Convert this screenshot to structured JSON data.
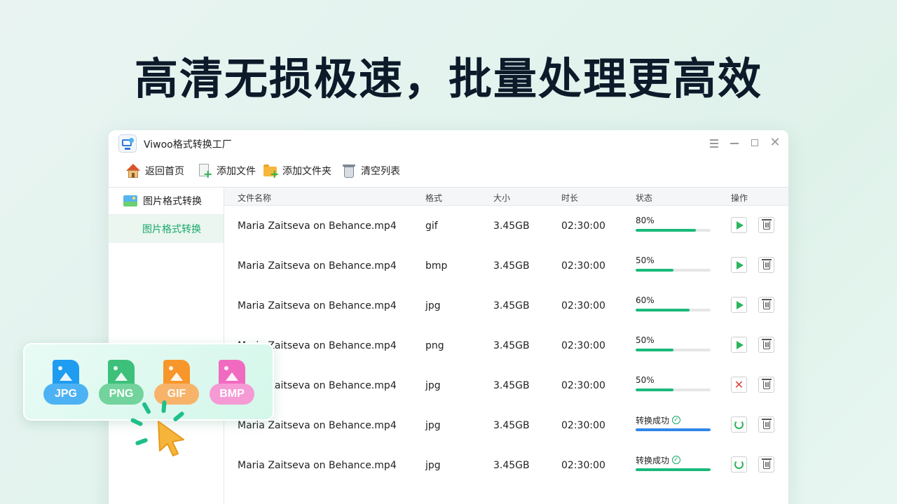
{
  "headline": "高清无损极速，批量处理更高效",
  "window": {
    "title": "Viwoo格式转换工厂",
    "controls": [
      "menu-icon",
      "minimize-icon",
      "maximize-icon",
      "close-icon"
    ]
  },
  "toolbar": {
    "home": "返回首页",
    "add_file": "添加文件",
    "add_folder": "添加文件夹",
    "clear_list": "清空列表"
  },
  "sidebar": {
    "group": "图片格式转换",
    "items": [
      {
        "label": "图片格式转换",
        "active": true
      }
    ]
  },
  "table": {
    "headers": {
      "name": "文件名称",
      "format": "格式",
      "size": "大小",
      "duration": "时长",
      "status": "状态",
      "actions": "操作"
    },
    "rows": [
      {
        "name": "Maria Zaitseva on Behance.mp4",
        "format": "gif",
        "size": "3.45GB",
        "duration": "02:30:00",
        "status": "80%",
        "progress": 0.8,
        "bar_color": "#19b97a",
        "action": "play"
      },
      {
        "name": "Maria Zaitseva on Behance.mp4",
        "format": "bmp",
        "size": "3.45GB",
        "duration": "02:30:00",
        "status": "50%",
        "progress": 0.5,
        "bar_color": "#19b97a",
        "action": "play"
      },
      {
        "name": "Maria Zaitseva on Behance.mp4",
        "format": "jpg",
        "size": "3.45GB",
        "duration": "02:30:00",
        "status": "60%",
        "progress": 0.72,
        "bar_color": "#19b97a",
        "action": "play"
      },
      {
        "name": "Maria Zaitseva on Behance.mp4",
        "format": "png",
        "size": "3.45GB",
        "duration": "02:30:00",
        "status": "50%",
        "progress": 0.5,
        "bar_color": "#19b97a",
        "action": "play"
      },
      {
        "name": "Maria Zaitseva on Behance.mp4",
        "format": "jpg",
        "size": "3.45GB",
        "duration": "02:30:00",
        "status": "50%",
        "progress": 0.5,
        "bar_color": "#19b97a",
        "action": "stop"
      },
      {
        "name": "Maria Zaitseva on Behance.mp4",
        "format": "jpg",
        "size": "3.45GB",
        "duration": "02:30:00",
        "status": "转换成功",
        "progress": 1.0,
        "bar_color": "#2f86e8",
        "action": "redo"
      },
      {
        "name": "Maria Zaitseva on Behance.mp4",
        "format": "jpg",
        "size": "3.45GB",
        "duration": "02:30:00",
        "status": "转换成功",
        "progress": 1.0,
        "bar_color": "#19b97a",
        "action": "redo"
      }
    ]
  },
  "format_badges": [
    {
      "label": "JPG",
      "color": "#1e9cf0"
    },
    {
      "label": "PNG",
      "color": "#3cc07a"
    },
    {
      "label": "GIF",
      "color": "#f7962a"
    },
    {
      "label": "BMP",
      "color": "#f06ac0"
    }
  ],
  "colors": {
    "accent": "#1aa869",
    "success": "#19b97a",
    "danger": "#e0403a",
    "info": "#2f86e8"
  }
}
